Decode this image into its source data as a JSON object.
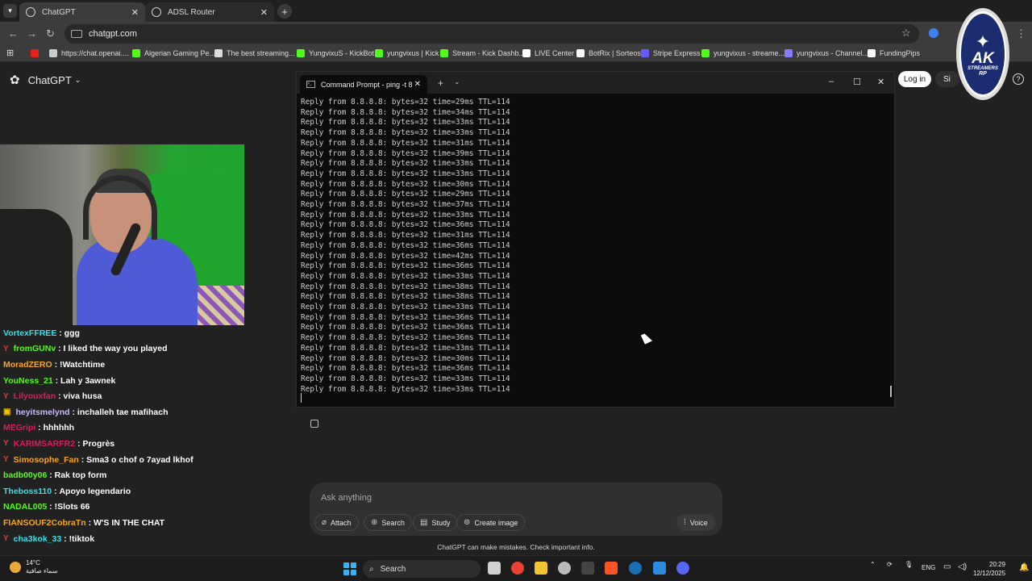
{
  "browser": {
    "tabs": [
      {
        "label": "ChatGPT",
        "active": true
      },
      {
        "label": "ADSL Router",
        "active": false
      }
    ],
    "url": "chatgpt.com",
    "bookmarks": [
      {
        "label": "",
        "icon": "youtube-icon",
        "color": "#e62117"
      },
      {
        "label": "https://chat.openai....",
        "icon": "openai-icon",
        "color": "#cccccc"
      },
      {
        "label": "Algerian Gaming Pe...",
        "icon": "kick-icon",
        "color": "#53fc18"
      },
      {
        "label": "The best streaming...",
        "icon": "diamond-icon",
        "color": "#dddddd"
      },
      {
        "label": "YungvixuS - KickBot",
        "icon": "kickbot-icon",
        "color": "#53fc18"
      },
      {
        "label": "yungvixus | Kick",
        "icon": "kick-icon",
        "color": "#53fc18"
      },
      {
        "label": "Stream - Kick Dashb...",
        "icon": "kick-icon",
        "color": "#53fc18"
      },
      {
        "label": "LIVE Center",
        "icon": "tiktok-icon",
        "color": "#ffffff"
      },
      {
        "label": "BotRix | Sorteos",
        "icon": "botrix-icon",
        "color": "#ffffff"
      },
      {
        "label": "Stripe Express",
        "icon": "stripe-icon",
        "color": "#635bff"
      },
      {
        "label": "yungvixus - streame...",
        "icon": "streamelements-icon",
        "color": "#53fc18"
      },
      {
        "label": "yungvixus - Channel...",
        "icon": "channel-icon",
        "color": "#8a7cff"
      },
      {
        "label": "FundingPips",
        "icon": "fundingpips-icon",
        "color": "#ffffff"
      }
    ]
  },
  "chatgpt": {
    "brand": "ChatGPT",
    "login": "Log in",
    "signup": "Si",
    "composer_placeholder": "Ask anything",
    "actions": [
      {
        "label": "Attach",
        "glyph": "⌀"
      },
      {
        "label": "Search",
        "glyph": "⊕"
      },
      {
        "label": "Study",
        "glyph": "▤"
      },
      {
        "label": "Create image",
        "glyph": "⊚"
      }
    ],
    "voice": "Voice",
    "disclaimer": "ChatGPT can make mistakes. Check important info."
  },
  "terminal": {
    "title": "Command Prompt - ping  -t 8",
    "lines": [
      "Reply from 8.8.8.8: bytes=32 time=29ms TTL=114",
      "Reply from 8.8.8.8: bytes=32 time=34ms TTL=114",
      "Reply from 8.8.8.8: bytes=32 time=33ms TTL=114",
      "Reply from 8.8.8.8: bytes=32 time=33ms TTL=114",
      "Reply from 8.8.8.8: bytes=32 time=31ms TTL=114",
      "Reply from 8.8.8.8: bytes=32 time=39ms TTL=114",
      "Reply from 8.8.8.8: bytes=32 time=33ms TTL=114",
      "Reply from 8.8.8.8: bytes=32 time=33ms TTL=114",
      "Reply from 8.8.8.8: bytes=32 time=30ms TTL=114",
      "Reply from 8.8.8.8: bytes=32 time=29ms TTL=114",
      "Reply from 8.8.8.8: bytes=32 time=37ms TTL=114",
      "Reply from 8.8.8.8: bytes=32 time=33ms TTL=114",
      "Reply from 8.8.8.8: bytes=32 time=36ms TTL=114",
      "Reply from 8.8.8.8: bytes=32 time=31ms TTL=114",
      "Reply from 8.8.8.8: bytes=32 time=36ms TTL=114",
      "Reply from 8.8.8.8: bytes=32 time=42ms TTL=114",
      "Reply from 8.8.8.8: bytes=32 time=36ms TTL=114",
      "Reply from 8.8.8.8: bytes=32 time=33ms TTL=114",
      "Reply from 8.8.8.8: bytes=32 time=38ms TTL=114",
      "Reply from 8.8.8.8: bytes=32 time=38ms TTL=114",
      "Reply from 8.8.8.8: bytes=32 time=33ms TTL=114",
      "Reply from 8.8.8.8: bytes=32 time=36ms TTL=114",
      "Reply from 8.8.8.8: bytes=32 time=36ms TTL=114",
      "Reply from 8.8.8.8: bytes=32 time=36ms TTL=114",
      "Reply from 8.8.8.8: bytes=32 time=33ms TTL=114",
      "Reply from 8.8.8.8: bytes=32 time=30ms TTL=114",
      "Reply from 8.8.8.8: bytes=32 time=36ms TTL=114",
      "Reply from 8.8.8.8: bytes=32 time=33ms TTL=114",
      "Reply from 8.8.8.8: bytes=32 time=33ms TTL=114"
    ]
  },
  "chat": [
    {
      "user": "VortexFFREE",
      "text": "ggg",
      "color": "#35e0e6",
      "badge": ""
    },
    {
      "user": "fromGUNv",
      "text": "I liked the way you played",
      "color": "#53fc18",
      "badge": "Y"
    },
    {
      "user": "MoradZERO",
      "text": "!Watchtime",
      "color": "#f5a623",
      "badge": ""
    },
    {
      "user": "YouNess_21",
      "text": "Lah y 3awnek",
      "color": "#53fc18",
      "badge": ""
    },
    {
      "user": "Lilyouxfan",
      "text": "viva husa",
      "color": "#d81e5b",
      "badge": "Y"
    },
    {
      "user": "heyitsmelynd",
      "text": "inchalleh tae mafihach",
      "color": "#c9b7ff",
      "badge": "▣"
    },
    {
      "user": "MEGripi",
      "text": "hhhhhh",
      "color": "#d81e5b",
      "badge": ""
    },
    {
      "user": "KARIMSARFR2",
      "text": "Progrès",
      "color": "#d81e5b",
      "badge": "Y"
    },
    {
      "user": "Simosophe_Fan",
      "text": "Sma3 o chof o 7ayad lkhof",
      "color": "#f5a623",
      "badge": "Y"
    },
    {
      "user": "badb00y06",
      "text": "Rak top form",
      "color": "#53fc18",
      "badge": ""
    },
    {
      "user": "Theboss110",
      "text": "Apoyo legendario",
      "color": "#35e0e6",
      "badge": ""
    },
    {
      "user": "NADAL005",
      "text": "!Slots 66",
      "color": "#53fc18",
      "badge": ""
    },
    {
      "user": "FIANSOUF2CobraTn",
      "text": "W'S IN THE CHAT",
      "color": "#f5a623",
      "badge": ""
    },
    {
      "user": "cha3kok_33",
      "text": "!tiktok",
      "color": "#35e0e6",
      "badge": "Y"
    }
  ],
  "overlay": {
    "logo_title": "AK",
    "logo_sub": "STREAMERS",
    "logo_sub2": "RP"
  },
  "taskbar": {
    "temp": "14°C",
    "weather": "سماء صافية",
    "search": "Search",
    "lang": "ENG",
    "time": "20:29",
    "date": "12/12/2025",
    "apps": [
      {
        "name": "task-view-icon",
        "color": "#d0d0d0"
      },
      {
        "name": "chrome-icon",
        "color": "#e94235"
      },
      {
        "name": "file-explorer-icon",
        "color": "#f4c430"
      },
      {
        "name": "settings-app-icon",
        "color": "#bbbbbb"
      },
      {
        "name": "terminal-icon",
        "color": "#444444"
      },
      {
        "name": "brave-icon",
        "color": "#fb542b"
      },
      {
        "name": "steam-icon",
        "color": "#1b6db4"
      },
      {
        "name": "photos-icon",
        "color": "#2b8be0"
      },
      {
        "name": "discord-icon",
        "color": "#5865f2"
      }
    ]
  }
}
